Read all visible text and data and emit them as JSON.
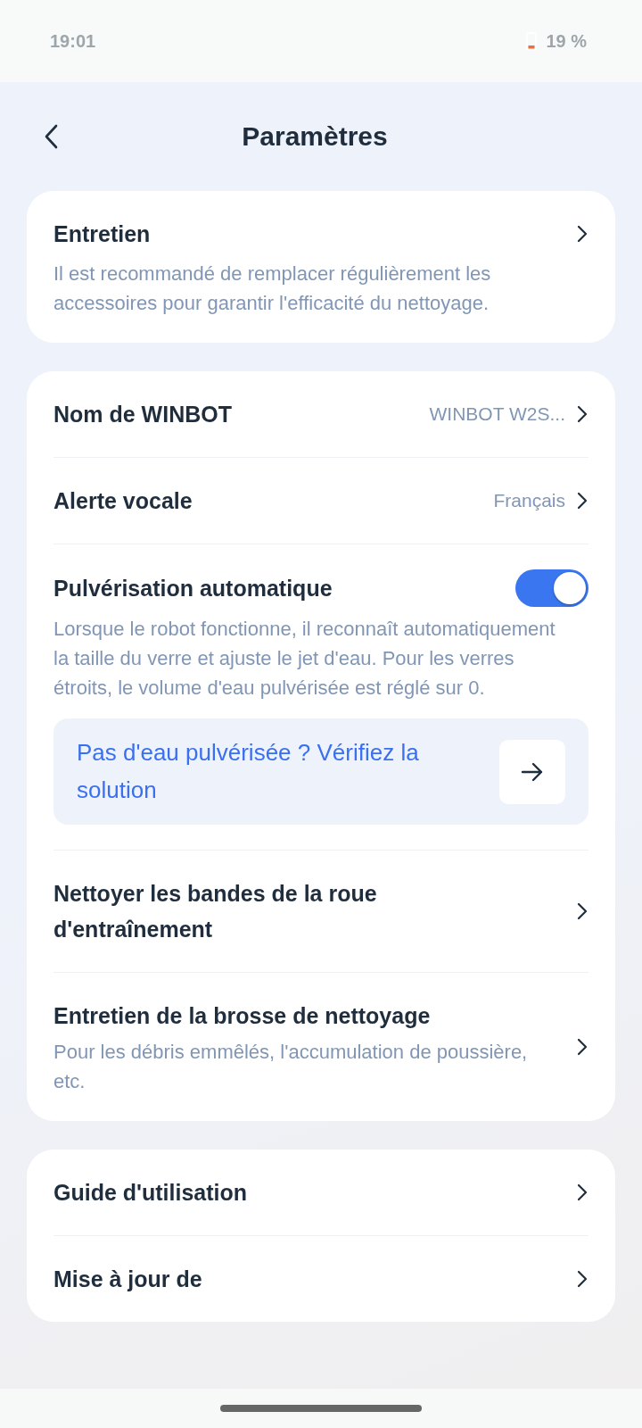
{
  "status_bar": {
    "time": "19:01",
    "battery": "19 %"
  },
  "header": {
    "title": "Paramètres"
  },
  "cards": [
    {
      "rows": [
        {
          "kind": "nav",
          "label": "Entretien",
          "description": "Il est recommandé de remplacer régulièrement les accessoires pour garantir l'efficacité du nettoyage."
        }
      ]
    },
    {
      "rows": [
        {
          "kind": "nav",
          "label": "Nom de WINBOT",
          "value": "WINBOT W2S..."
        },
        {
          "kind": "nav",
          "label": "Alerte vocale",
          "value": "Français"
        },
        {
          "kind": "toggle",
          "label": "Pulvérisation automatique",
          "on": true,
          "description": "Lorsque le robot fonctionne, il reconnaît automatiquement la taille du verre et ajuste le jet d'eau. Pour les verres étroits, le volume d'eau pulvérisée est réglé sur 0.",
          "help_link": "Pas d'eau pulvérisée ? Vérifiez la solution"
        },
        {
          "kind": "nav",
          "label": "Nettoyer les bandes de la roue d'entraînement"
        },
        {
          "kind": "nav",
          "label": "Entretien de la brosse de nettoyage",
          "description": "Pour les débris emmêlés, l'accumulation de poussière, etc."
        }
      ]
    },
    {
      "rows": [
        {
          "kind": "nav",
          "label": "Guide d'utilisation"
        },
        {
          "kind": "nav",
          "label": "Mise à jour de"
        }
      ]
    }
  ]
}
